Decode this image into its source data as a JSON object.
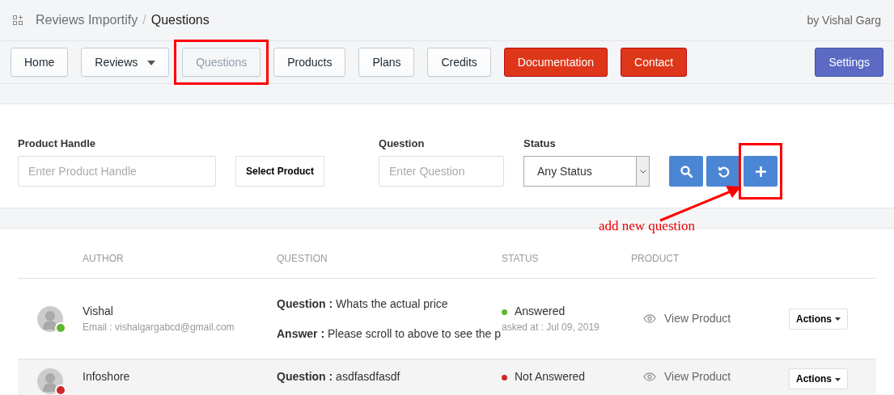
{
  "header": {
    "breadcrumb": [
      "Reviews Importify",
      "Questions"
    ],
    "separator": "/",
    "byline": "by Vishal Garg"
  },
  "nav": [
    {
      "label": "Home",
      "kind": "plain",
      "selected": false,
      "highlighted": false
    },
    {
      "label": "Reviews",
      "kind": "dropdown",
      "selected": false,
      "highlighted": false
    },
    {
      "label": "Questions",
      "kind": "plain",
      "selected": true,
      "highlighted": true
    },
    {
      "label": "Products",
      "kind": "plain",
      "selected": false,
      "highlighted": false
    },
    {
      "label": "Plans",
      "kind": "plain",
      "selected": false,
      "highlighted": false
    },
    {
      "label": "Credits",
      "kind": "plain",
      "selected": false,
      "highlighted": false
    },
    {
      "label": "Documentation",
      "kind": "danger",
      "selected": false,
      "highlighted": false
    },
    {
      "label": "Contact",
      "kind": "danger",
      "selected": false,
      "highlighted": false
    },
    {
      "label": "Settings",
      "kind": "primary",
      "selected": false,
      "highlighted": false
    }
  ],
  "filters": {
    "product_handle": {
      "label": "Product Handle",
      "placeholder": "Enter Product Handle"
    },
    "select_product": "Select Product",
    "question": {
      "label": "Question",
      "placeholder": "Enter Question"
    },
    "status": {
      "label": "Status",
      "value": "Any Status"
    },
    "buttons": [
      {
        "kind": "search",
        "highlighted": false
      },
      {
        "kind": "reset",
        "highlighted": false
      },
      {
        "kind": "add",
        "highlighted": true
      }
    ]
  },
  "annotation": {
    "text": "add new question"
  },
  "table": {
    "columns": [
      "AUTHOR",
      "QUESTION",
      "STATUS",
      "PRODUCT"
    ],
    "rows": [
      {
        "author": "Vishal",
        "email": "Email : vishalgargabcd@gmail.com",
        "question": "**Question :** Whats the actual price",
        "answer": "**Answer :** Please scroll to above to see the p",
        "status": "Answered",
        "color": "#5cb82e",
        "asked": "asked at : Jul 09, 2019",
        "product_link": "View Product",
        "actions": "Actions",
        "selected": false
      },
      {
        "author": "Infoshore",
        "question": "**Question :** asdfasdfasdf",
        "status": "Not Answered",
        "color": "#d0282a",
        "product_link": "View Product",
        "actions": "Actions",
        "selected": true
      }
    ]
  }
}
